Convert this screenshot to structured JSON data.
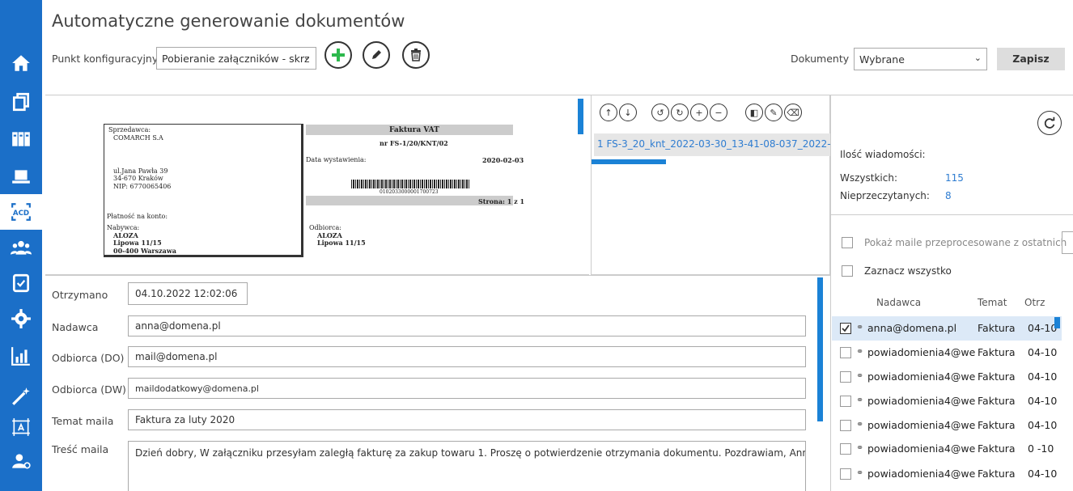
{
  "header": {
    "title": "Automatyczne generowanie dokumentów",
    "config_label": "Punkt konfiguracyjny",
    "config_value": "Pobieranie załączników - skrz",
    "documents_label": "Dokumenty",
    "documents_value": "Wybrane",
    "save_label": "Zapisz"
  },
  "sidebar": {
    "items": [
      {
        "icon": "home-icon"
      },
      {
        "icon": "documents-icon"
      },
      {
        "icon": "binders-icon"
      },
      {
        "icon": "laptop-icon"
      },
      {
        "icon": "acd-icon",
        "label": "ACD"
      },
      {
        "icon": "users-icon"
      },
      {
        "icon": "document-edit-icon"
      },
      {
        "icon": "gear-icon"
      },
      {
        "icon": "chart-icon"
      },
      {
        "icon": "magic-wand-icon"
      },
      {
        "icon": "layout-icon"
      },
      {
        "icon": "user-settings-icon"
      }
    ]
  },
  "invoice_preview": {
    "seller_label": "Sprzedawca:",
    "seller_name": "COMARCH S.A",
    "seller_street": "ul.Jana Pawła 39",
    "seller_city": "34-670 Kraków",
    "seller_nip": "NIP: 6770065406",
    "invoice_title": "Faktura VAT",
    "invoice_number": "nr FS-1/20/KNT/02",
    "issue_date_label": "Data wystawienia:",
    "issue_date": "2020-02-03",
    "barcode_number": "0102033000001700723",
    "page": "Strona: 1 z 1",
    "payment": "Płatność na konto:",
    "buyer_label": "Nabywca:",
    "buyer_name": "ALOZA",
    "buyer_street": "Lipowa 11/15",
    "buyer_city": "00-400 Warszawa",
    "recipient_label": "Odbiorca:",
    "recipient_name": "ALOZA",
    "recipient_street": "Lipowa 11/15"
  },
  "attachments": {
    "items": [
      "1 FS-3_20_knt_2022-03-30_13-41-08-037_2022-("
    ]
  },
  "mail_form": {
    "received_label": "Otrzymano",
    "received_value": "04.10.2022 12:02:06",
    "sender_label": "Nadawca",
    "sender_value": "anna@domena.pl",
    "to_label": "Odbiorca (DO)",
    "to_value": "mail@domena.pl",
    "cc_label": "Odbiorca (DW)",
    "cc_value": "maildodatkowy@domena.pl",
    "subject_label": "Temat maila",
    "subject_value": "Faktura za luty 2020",
    "body_label": "Treść maila",
    "body_value": "Dzień dobry,   W załączniku przesyłam zaległą fakturę za zakup towaru 1. Proszę o potwierdzenie otrzymania dokumentu.   Pozdrawiam, Anna Sa"
  },
  "stats": {
    "title": "Ilość wiadomości:",
    "all_label": "Wszystkich:",
    "all_value": "115",
    "unread_label": "Nieprzeczytanych:",
    "unread_value": "8"
  },
  "mail_list": {
    "show_processed_label": "Pokaż maile przeprocesowane z ostatnich",
    "select_all_label": "Zaznacz wszystko",
    "columns": [
      "Nadawca",
      "Temat",
      "Otrz"
    ],
    "rows": [
      {
        "sender": "anna@domena.pl",
        "subject": "Faktura",
        "date": "04-10",
        "checked": true
      },
      {
        "sender": "powiadomienia4@we",
        "subject": "Faktura",
        "date": "04-10",
        "checked": false
      },
      {
        "sender": "powiadomienia4@we",
        "subject": "Faktura",
        "date": "04-10",
        "checked": false
      },
      {
        "sender": "powiadomienia4@we",
        "subject": "Faktura",
        "date": "04-10",
        "checked": false
      },
      {
        "sender": "powiadomienia4@we",
        "subject": "Faktura",
        "date": "04-10",
        "checked": false
      },
      {
        "sender": "powiadomienia4@we",
        "subject": "Faktura",
        "date": "0 -10",
        "checked": false
      },
      {
        "sender": "powiadomienia4@we",
        "subject": "Faktura",
        "date": "04-10",
        "checked": false
      }
    ]
  },
  "colors": {
    "sidebar": "#1b6fc8",
    "accent": "#2f7dd1",
    "add_green": "#2db84d"
  }
}
